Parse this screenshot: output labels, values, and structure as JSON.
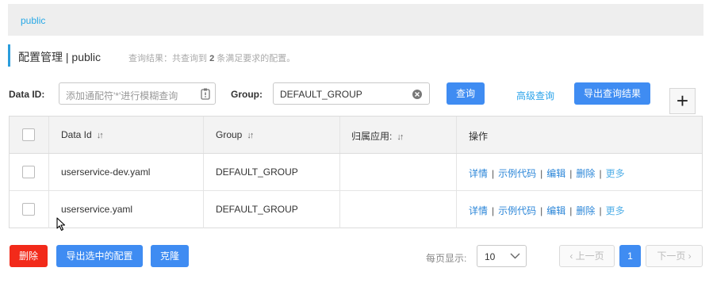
{
  "tab": {
    "label": "public"
  },
  "header": {
    "title": "配置管理 | public",
    "result_prefix": "查询结果：共查询到",
    "result_count": "2",
    "result_suffix": "条满足要求的配置。"
  },
  "filter": {
    "data_id_label": "Data ID:",
    "data_id_placeholder": "添加通配符'*'进行模糊查询",
    "group_label": "Group:",
    "group_value": "DEFAULT_GROUP",
    "query_button": "查询",
    "advanced_query": "高级查询",
    "export_results_button": "导出查询结果",
    "add_button": "+"
  },
  "table": {
    "columns": [
      "Data Id",
      "Group",
      "归属应用:",
      "操作"
    ],
    "rows": [
      {
        "data_id": "userservice-dev.yaml",
        "group": "DEFAULT_GROUP",
        "app": ""
      },
      {
        "data_id": "userservice.yaml",
        "group": "DEFAULT_GROUP",
        "app": ""
      }
    ],
    "actions": [
      "详情",
      "示例代码",
      "编辑",
      "删除",
      "更多"
    ]
  },
  "footer": {
    "delete_button": "删除",
    "export_selected_button": "导出选中的配置",
    "clone_button": "克隆",
    "page_size_label": "每页显示:",
    "page_size_value": "10",
    "prev_label": "上一页",
    "current_page": "1",
    "next_label": "下一页"
  },
  "colors": {
    "accent_blue": "#3f8cf2",
    "danger_red": "#f22a1a",
    "link_blue": "#2b86d8"
  },
  "icons": [
    "clipboard-icon",
    "clear-icon",
    "sort-icon",
    "chevron-down-icon",
    "chevron-left-icon",
    "chevron-right-icon",
    "mouse-cursor-icon"
  ]
}
